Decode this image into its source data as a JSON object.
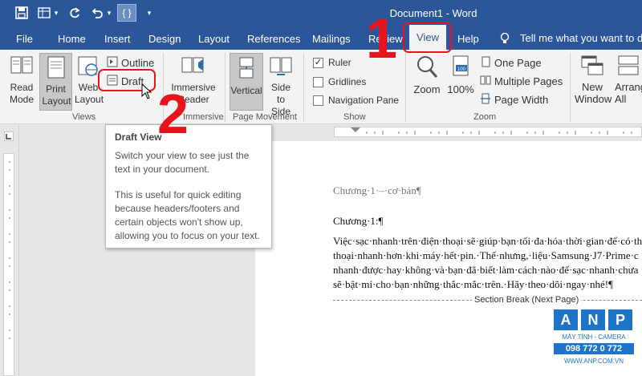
{
  "window": {
    "title": "Document1  -  Word"
  },
  "tabs": [
    "File",
    "Home",
    "Insert",
    "Design",
    "Layout",
    "References",
    "Mailings",
    "Review",
    "View",
    "Help"
  ],
  "active_tab": "View",
  "tell_me": "Tell me what you want to do",
  "ribbon": {
    "views": {
      "read_mode": "Read Mode",
      "print_layout": "Print Layout",
      "web_layout": "Web Layout",
      "outline": "Outline",
      "draft": "Draft",
      "label": "Views"
    },
    "immersive": {
      "reader": "Immersive Reader",
      "label": "Immersive"
    },
    "page_movement": {
      "vertical": "Vertical",
      "side": "Side to Side",
      "label": "Page Movement"
    },
    "show": {
      "ruler": "Ruler",
      "gridlines": "Gridlines",
      "nav_pane": "Navigation Pane",
      "label": "Show",
      "ruler_checked": true,
      "gridlines_checked": false,
      "nav_checked": false
    },
    "zoom": {
      "zoom": "Zoom",
      "hundred": "100%",
      "one_page": "One Page",
      "multiple_pages": "Multiple Pages",
      "page_width": "Page Width",
      "label": "Zoom"
    },
    "window": {
      "new_window": "New Window",
      "arrange_all": "Arrange All"
    }
  },
  "tooltip": {
    "title": "Draft View",
    "line1": "Switch your view to see just the text in your document.",
    "line2": "This is useful for quick editing because headers/footers and certain objects won't show up, allowing you to focus on your text."
  },
  "document": {
    "header": "Chương·1·–·cơ·bản¶",
    "heading": "Chương·1:¶",
    "para": [
      "Việc·sạc·nhanh·trên·điện·thoại·sẽ·giúp·bạn·tối·đa·hóa·thời·gian·để·có·th",
      "thoại·nhanh·hơn·khi·máy·hết·pin.·Thế·nhưng,·liệu·Samsung·J7·Prime·c",
      "nhanh·được·hay·không·và·bạn·đã·biết·làm·cách·nào·để·sạc·nhanh·chưa",
      "sẽ·bật·mí·cho·bạn·những·thắc·mắc·trên.·Hãy·theo·dõi·ngay·nhé!¶"
    ],
    "section_break": "Section Break (Next Page)"
  },
  "annotations": {
    "one": "1",
    "two": "2",
    "color": "#e8141b"
  },
  "watermark": {
    "letters": [
      "A",
      "N",
      "P"
    ],
    "line1": "MÁY TÍNH - CAMERA",
    "phone": "098 772 0 772",
    "site": "WWW.ANP.COM.VN"
  },
  "colors": {
    "word_blue": "#2b579a",
    "ribbon_bg": "#f3f3f3"
  }
}
